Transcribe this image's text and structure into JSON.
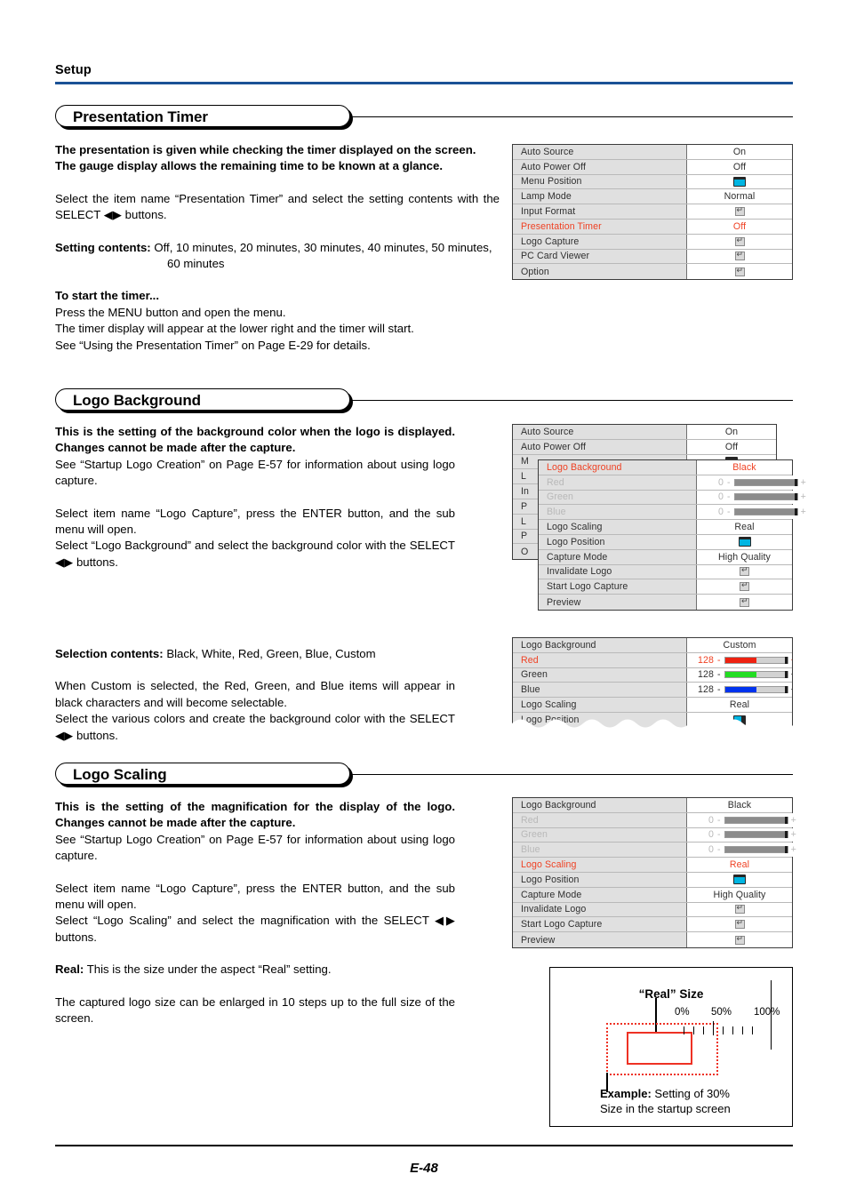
{
  "page": {
    "header": "Setup",
    "footer_page_number": "E-48",
    "accent_rule_color": "#1a5196"
  },
  "sections": [
    {
      "title": "Presentation Timer",
      "paragraphs": [
        "The presentation is given while checking the timer displayed on the screen.",
        "The gauge display allows the remaining time to be known at a glance.",
        "Select the item name “Presentation Timer” and select the setting contents with the SELECT ◀▶ buttons.",
        "Setting contents:",
        "Off, 10 minutes, 20 minutes, 30 minutes, 40 minutes, 50 minutes, 60 minutes",
        "To start the timer...",
        "Press the MENU button and open the menu.",
        "The timer display will appear at the lower right and the timer will start.",
        "See “Using the Presentation Timer” on Page E-29 for details."
      ]
    },
    {
      "title": "Logo Background",
      "paragraphs": [
        "This is the setting of the background color when the logo is displayed. Changes cannot be made after the capture.",
        "See “Startup Logo Creation” on Page E-57 for information about using logo capture.",
        "Select item name “Logo Capture”, press the ENTER button, and the sub menu will open.",
        "Select “Logo Background” and select the background color with the SELECT ◀▶ buttons.",
        "Selection contents:",
        "Black, White, Red, Green, Blue, Custom",
        "When Custom is selected, the Red, Green, and Blue items will appear in black characters and will become selectable.",
        "Select the various colors and create the background color with the SELECT ◀▶ buttons."
      ]
    },
    {
      "title": "Logo Scaling",
      "paragraphs": [
        "This is the setting of the magnification for the display of the logo. Changes cannot be made after the capture.",
        "See “Startup Logo Creation” on Page E-57 for information about using logo capture.",
        "Select item name “Logo Capture”, press the ENTER button, and the sub menu will open.",
        "Select “Logo Scaling” and select the magnification with the SELECT ◀▶ buttons.",
        "Real:",
        "This is the size under the aspect “Real” setting.",
        "The captured logo size can be enlarged in 10 steps up to the full size of the screen."
      ]
    }
  ],
  "menus": {
    "setup_main": {
      "rows": [
        {
          "name": "Auto Source",
          "value": "On",
          "type": "text",
          "highlighted": false
        },
        {
          "name": "Auto Power Off",
          "value": "Off",
          "type": "text",
          "highlighted": false
        },
        {
          "name": "Menu Position",
          "value": "",
          "type": "position-icon",
          "highlighted": false
        },
        {
          "name": "Lamp Mode",
          "value": "Normal",
          "type": "text",
          "highlighted": false
        },
        {
          "name": "Input Format",
          "value": "",
          "type": "enter-icon",
          "highlighted": false
        },
        {
          "name": "Presentation Timer",
          "value": "Off",
          "type": "text",
          "highlighted": true
        },
        {
          "name": "Logo Capture",
          "value": "",
          "type": "enter-icon",
          "highlighted": false
        },
        {
          "name": "PC Card Viewer",
          "value": "",
          "type": "enter-icon",
          "highlighted": false
        },
        {
          "name": "Option",
          "value": "",
          "type": "enter-icon",
          "highlighted": false
        }
      ]
    },
    "setup_behind": {
      "rows": [
        {
          "name": "Auto Source",
          "value": "On",
          "type": "text"
        },
        {
          "name": "Auto Power Off",
          "value": "Off",
          "type": "text"
        },
        {
          "name": "M",
          "value": "",
          "type": "position-icon"
        },
        {
          "name": "L",
          "value": "",
          "type": "clipped"
        },
        {
          "name": "In",
          "value": "",
          "type": "clipped"
        },
        {
          "name": "P",
          "value": "",
          "type": "clipped"
        },
        {
          "name": "L",
          "value": "",
          "type": "clipped"
        },
        {
          "name": "P",
          "value": "",
          "type": "clipped"
        },
        {
          "name": "O",
          "value": "",
          "type": "clipped"
        }
      ]
    },
    "logo_capture_black": {
      "rows": [
        {
          "name": "Logo Background",
          "value": "Black",
          "type": "text",
          "highlighted": true,
          "dimmed": false
        },
        {
          "name": "Red",
          "value": "0",
          "type": "slider",
          "highlighted": false,
          "dimmed": true,
          "slider_color": "#8c8c8c",
          "slider_pct": 100
        },
        {
          "name": "Green",
          "value": "0",
          "type": "slider",
          "highlighted": false,
          "dimmed": true,
          "slider_color": "#8c8c8c",
          "slider_pct": 100
        },
        {
          "name": "Blue",
          "value": "0",
          "type": "slider",
          "highlighted": false,
          "dimmed": true,
          "slider_color": "#8c8c8c",
          "slider_pct": 100
        },
        {
          "name": "Logo Scaling",
          "value": "Real",
          "type": "text",
          "highlighted": false,
          "dimmed": false
        },
        {
          "name": "Logo Position",
          "value": "",
          "type": "position-icon",
          "highlighted": false,
          "dimmed": false
        },
        {
          "name": "Capture Mode",
          "value": "High Quality",
          "type": "text",
          "highlighted": false,
          "dimmed": false
        },
        {
          "name": "Invalidate Logo",
          "value": "",
          "type": "enter-icon",
          "highlighted": false,
          "dimmed": false
        },
        {
          "name": "Start Logo Capture",
          "value": "",
          "type": "enter-icon",
          "highlighted": false,
          "dimmed": false
        },
        {
          "name": "Preview",
          "value": "",
          "type": "enter-icon",
          "highlighted": false,
          "dimmed": false
        }
      ]
    },
    "logo_capture_custom": {
      "rows": [
        {
          "name": "Logo Background",
          "value": "Custom",
          "type": "text",
          "highlighted": false,
          "dimmed": false
        },
        {
          "name": "Red",
          "value": "128",
          "type": "slider",
          "highlighted": true,
          "dimmed": false,
          "slider_color": "#ee2211",
          "slider_pct": 50
        },
        {
          "name": "Green",
          "value": "128",
          "type": "slider",
          "highlighted": false,
          "dimmed": false,
          "slider_color": "#22dd22",
          "slider_pct": 50
        },
        {
          "name": "Blue",
          "value": "128",
          "type": "slider",
          "highlighted": false,
          "dimmed": false,
          "slider_color": "#0033ee",
          "slider_pct": 50
        },
        {
          "name": "Logo Scaling",
          "value": "Real",
          "type": "text",
          "highlighted": false,
          "dimmed": false
        },
        {
          "name": "Logo Position",
          "value": "",
          "type": "position-icon-right",
          "highlighted": false,
          "dimmed": false
        }
      ]
    },
    "logo_scaling_menu": {
      "rows": [
        {
          "name": "Logo Background",
          "value": "Black",
          "type": "text",
          "highlighted": false,
          "dimmed": false
        },
        {
          "name": "Red",
          "value": "0",
          "type": "slider",
          "highlighted": false,
          "dimmed": true,
          "slider_color": "#8c8c8c",
          "slider_pct": 100
        },
        {
          "name": "Green",
          "value": "0",
          "type": "slider",
          "highlighted": false,
          "dimmed": true,
          "slider_color": "#8c8c8c",
          "slider_pct": 100
        },
        {
          "name": "Blue",
          "value": "0",
          "type": "slider",
          "highlighted": false,
          "dimmed": true,
          "slider_color": "#8c8c8c",
          "slider_pct": 100
        },
        {
          "name": "Logo Scaling",
          "value": "Real",
          "type": "text",
          "highlighted": true,
          "dimmed": false
        },
        {
          "name": "Logo Position",
          "value": "",
          "type": "position-icon",
          "highlighted": false,
          "dimmed": false
        },
        {
          "name": "Capture Mode",
          "value": "High Quality",
          "type": "text",
          "highlighted": false,
          "dimmed": false
        },
        {
          "name": "Invalidate Logo",
          "value": "",
          "type": "enter-icon",
          "highlighted": false,
          "dimmed": false
        },
        {
          "name": "Start Logo Capture",
          "value": "",
          "type": "enter-icon",
          "highlighted": false,
          "dimmed": false
        },
        {
          "name": "Preview",
          "value": "",
          "type": "enter-icon",
          "highlighted": false,
          "dimmed": false
        }
      ]
    }
  },
  "figure": {
    "title": "“Real” Size",
    "scale_labels": [
      "0%",
      "50%",
      "100%"
    ],
    "caption_label": "Example:",
    "caption_rest": " Setting of 30%",
    "caption_line2": "Size in the startup screen",
    "box_color": "#ee3124"
  }
}
